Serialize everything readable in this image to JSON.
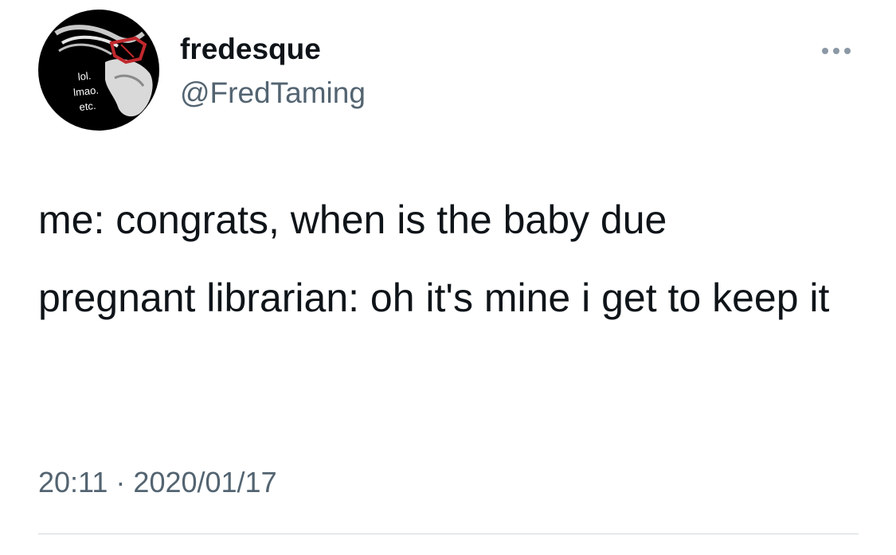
{
  "author": {
    "display_name": "fredesque",
    "handle": "@FredTaming",
    "avatar_caption": [
      "lol.",
      "lmao.",
      "etc."
    ]
  },
  "tweet": {
    "lines": [
      "me: congrats, when is the baby due",
      "pregnant librarian: oh it's mine i get to keep it"
    ],
    "time": "20:11",
    "separator": "·",
    "date": "2020/01/17"
  },
  "icons": {
    "more": "more-options-icon"
  },
  "colors": {
    "text_primary": "#0f1419",
    "text_secondary": "#536471",
    "divider": "#cfd9de",
    "background": "#ffffff"
  }
}
